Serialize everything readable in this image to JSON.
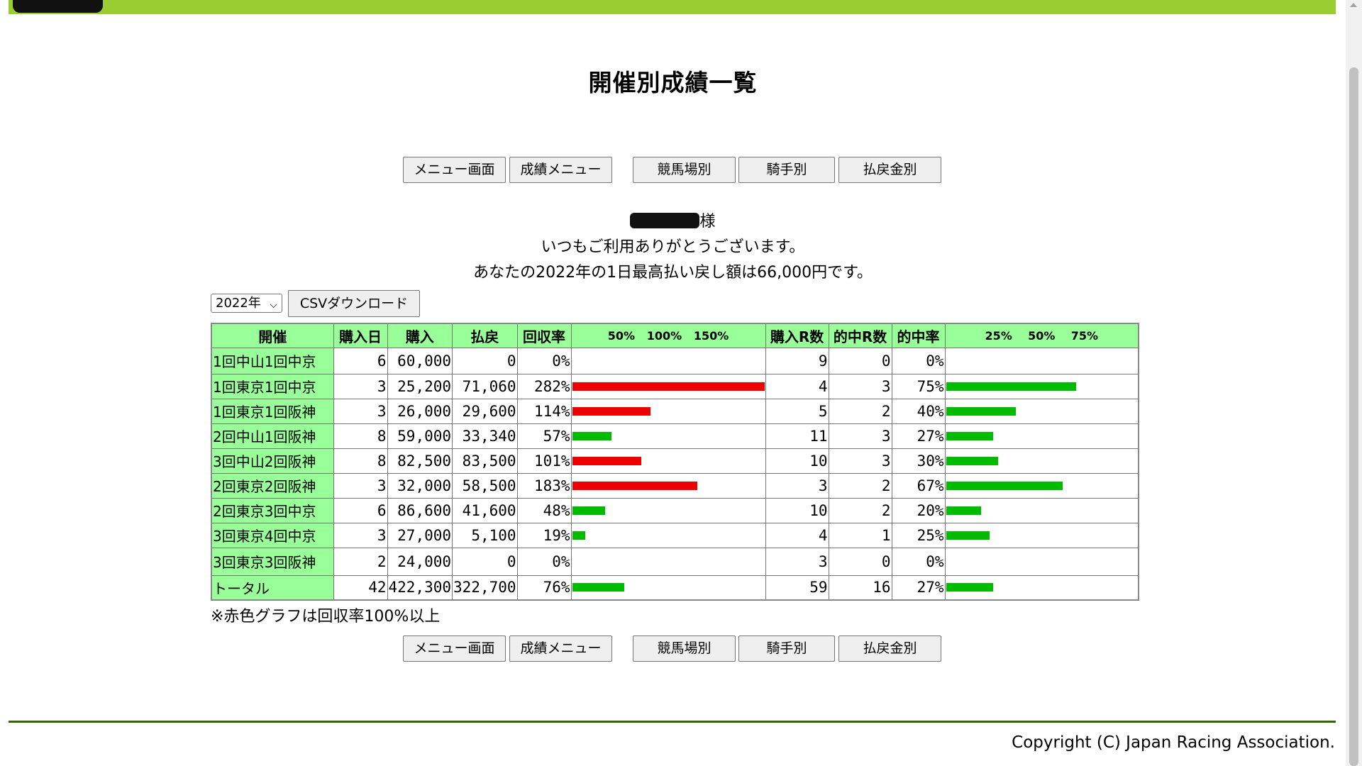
{
  "header": {
    "title": "開催別成績一覧"
  },
  "nav": {
    "menu": "メニュー画面",
    "results_menu": "成績メニュー",
    "by_racecourse": "競馬場別",
    "by_jockey": "騎手別",
    "by_payout": "払戻金別"
  },
  "greeting": {
    "honorific": "様",
    "thanks": "いつもご利用ありがとうございます。",
    "prefix": "あなたの",
    "year_text": "2022年",
    "middle": "の1日最高払い戻し額は",
    "max_payout": "66,000円",
    "suffix": "です。"
  },
  "controls": {
    "year_selected": "2022年",
    "csv_button": "CSVダウンロード"
  },
  "table": {
    "headers": {
      "meeting": "開催",
      "purchase_days": "購入日",
      "purchase": "購入",
      "payout": "払戻",
      "return_rate": "回収率",
      "return_scale": "50%   100%   150%",
      "races_bought": "購入R数",
      "races_hit": "的中R数",
      "hit_rate": "的中率",
      "hit_scale": "25%    50%    75%"
    },
    "rows": [
      {
        "meeting": "1回中山1回中京",
        "days": "6",
        "purchase": "60,000",
        "payout": "0",
        "return_rate": "0%",
        "return_value": 0,
        "races": "9",
        "hits": "0",
        "hit_rate": "0%",
        "hit_value": 0
      },
      {
        "meeting": "1回東京1回中京",
        "days": "3",
        "purchase": "25,200",
        "payout": "71,060",
        "return_rate": "282%",
        "return_value": 282,
        "races": "4",
        "hits": "3",
        "hit_rate": "75%",
        "hit_value": 75
      },
      {
        "meeting": "1回東京1回阪神",
        "days": "3",
        "purchase": "26,000",
        "payout": "29,600",
        "return_rate": "114%",
        "return_value": 114,
        "races": "5",
        "hits": "2",
        "hit_rate": "40%",
        "hit_value": 40
      },
      {
        "meeting": "2回中山1回阪神",
        "days": "8",
        "purchase": "59,000",
        "payout": "33,340",
        "return_rate": "57%",
        "return_value": 57,
        "races": "11",
        "hits": "3",
        "hit_rate": "27%",
        "hit_value": 27
      },
      {
        "meeting": "3回中山2回阪神",
        "days": "8",
        "purchase": "82,500",
        "payout": "83,500",
        "return_rate": "101%",
        "return_value": 101,
        "races": "10",
        "hits": "3",
        "hit_rate": "30%",
        "hit_value": 30
      },
      {
        "meeting": "2回東京2回阪神",
        "days": "3",
        "purchase": "32,000",
        "payout": "58,500",
        "return_rate": "183%",
        "return_value": 183,
        "races": "3",
        "hits": "2",
        "hit_rate": "67%",
        "hit_value": 67
      },
      {
        "meeting": "2回東京3回中京",
        "days": "6",
        "purchase": "86,600",
        "payout": "41,600",
        "return_rate": "48%",
        "return_value": 48,
        "races": "10",
        "hits": "2",
        "hit_rate": "20%",
        "hit_value": 20
      },
      {
        "meeting": "3回東京4回中京",
        "days": "3",
        "purchase": "27,000",
        "payout": "5,100",
        "return_rate": "19%",
        "return_value": 19,
        "races": "4",
        "hits": "1",
        "hit_rate": "25%",
        "hit_value": 25
      },
      {
        "meeting": "3回東京3回阪神",
        "days": "2",
        "purchase": "24,000",
        "payout": "0",
        "return_rate": "0%",
        "return_value": 0,
        "races": "3",
        "hits": "0",
        "hit_rate": "0%",
        "hit_value": 0
      },
      {
        "meeting": "トータル",
        "days": "42",
        "purchase": "422,300",
        "payout": "322,700",
        "return_rate": "76%",
        "return_value": 76,
        "races": "59",
        "hits": "16",
        "hit_rate": "27%",
        "hit_value": 27
      }
    ]
  },
  "colors": {
    "header_bar": "#9acd32",
    "table_header": "#99ff99",
    "bar_over_100": "#ee0000",
    "bar_under_100": "#00bb00"
  },
  "note": "※赤色グラフは回収率100%以上",
  "footer": {
    "copyright": "Copyright (C) Japan Racing Association."
  }
}
